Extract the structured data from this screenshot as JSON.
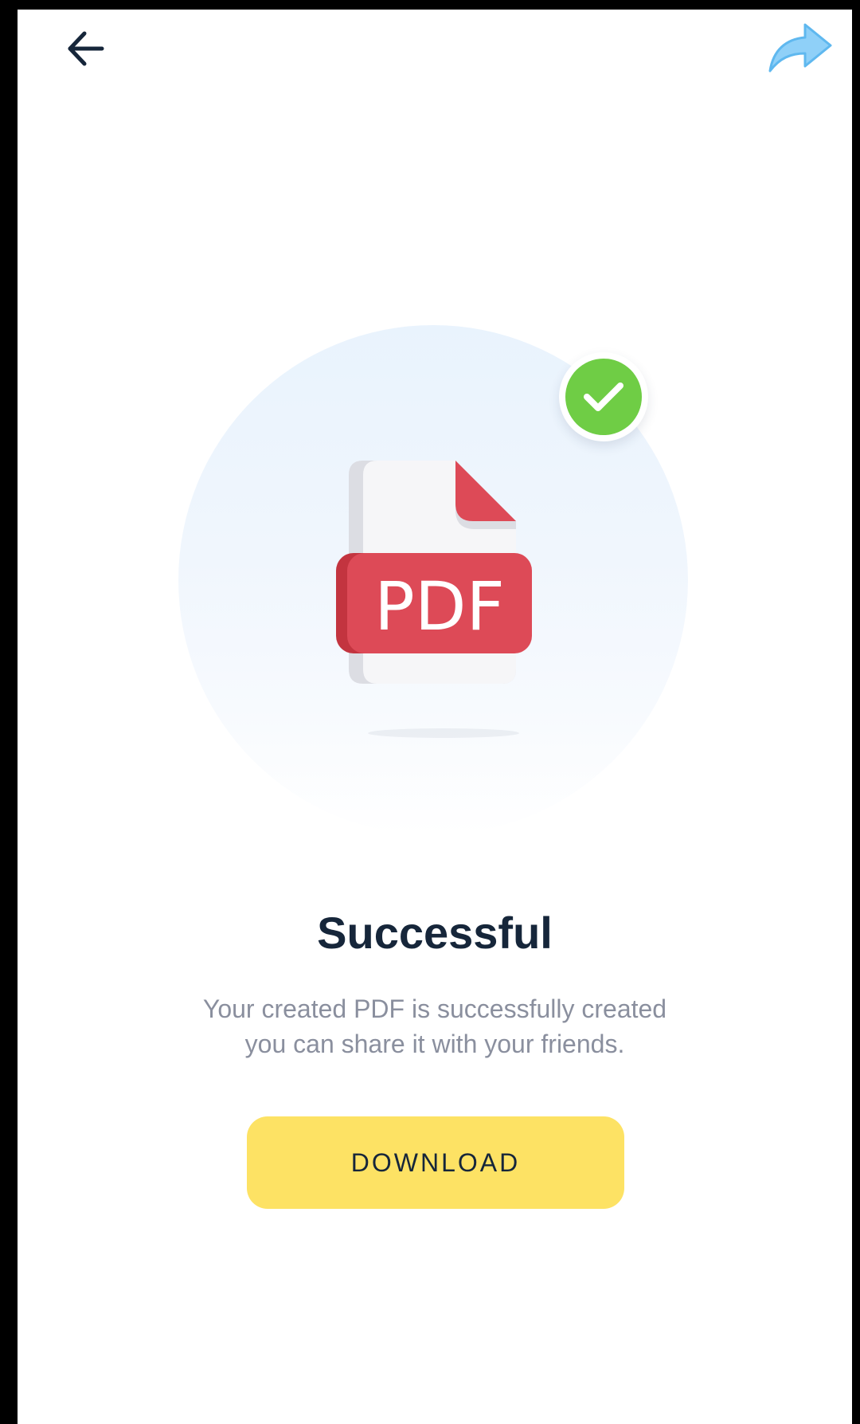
{
  "header": {
    "back_icon": "arrow-left-icon",
    "share_icon": "share-forward-icon"
  },
  "hero": {
    "file_badge_text": "PDF",
    "status_icon": "checkmark-icon"
  },
  "content": {
    "title": "Successful",
    "message_line_1": "Your created PDF is successfully created",
    "message_line_2": "you can share it with your friends."
  },
  "actions": {
    "download_label": "DOWNLOAD"
  },
  "colors": {
    "accent_yellow": "#fde264",
    "success_green": "#6fcd45",
    "pdf_red": "#dd4a57",
    "share_blue": "#7cc8f5",
    "title_dark": "#16263a"
  }
}
